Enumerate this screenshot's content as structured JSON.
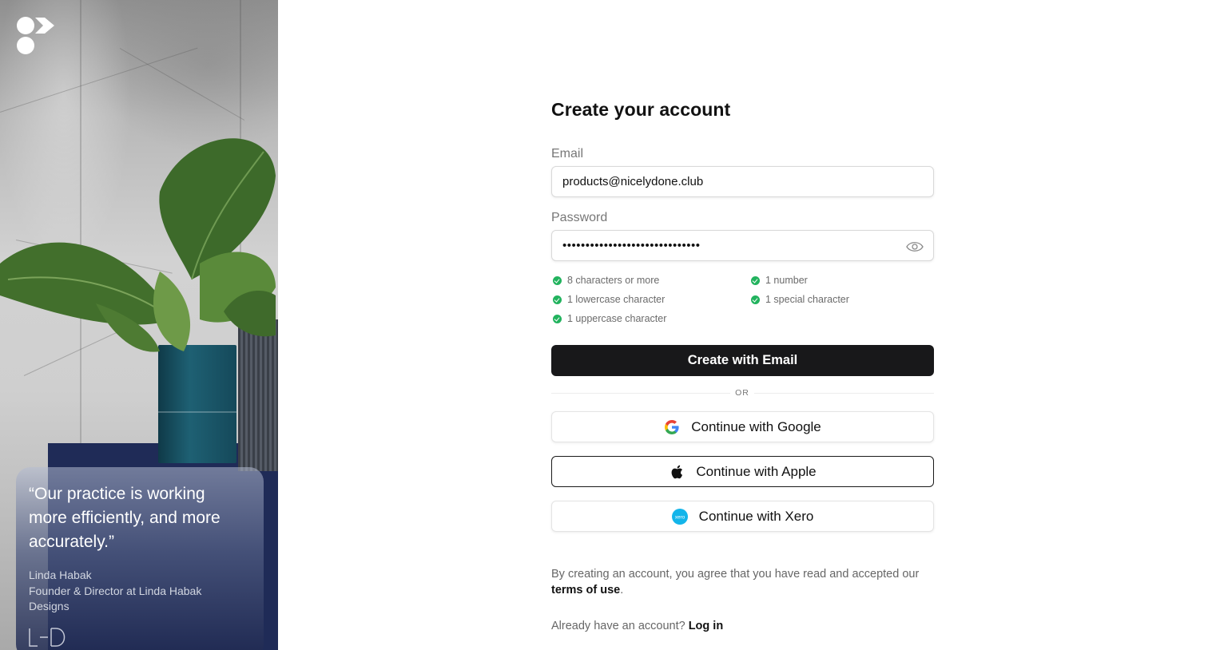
{
  "side_panel": {
    "quote": "“Our practice is working more efficiently, and more accurately.”",
    "author_name": "Linda Habak",
    "author_role": "Founder & Director at Linda Habak Designs",
    "brand_logo": "LHD"
  },
  "form": {
    "title": "Create your account",
    "email_label": "Email",
    "email_value": "products@nicelydone.club",
    "password_label": "Password",
    "password_value": "••••••••••••••••••••••••••••••",
    "requirements": [
      {
        "label": "8 characters or more",
        "met": true
      },
      {
        "label": "1 lowercase character",
        "met": true
      },
      {
        "label": "1 uppercase character",
        "met": true
      },
      {
        "label": "1 number",
        "met": true
      },
      {
        "label": "1 special character",
        "met": true
      }
    ],
    "primary_button": "Create with Email",
    "divider_text": "OR",
    "google_button": "Continue with Google",
    "apple_button": "Continue with Apple",
    "xero_button": "Continue with Xero",
    "terms_prefix": "By creating an account, you agree that you have read and accepted our",
    "terms_link": "terms of use",
    "terms_suffix": ".",
    "login_prompt": "Already have an account?",
    "login_link": "Log in"
  },
  "colors": {
    "primary_button": "#18181a",
    "check": "#22b35e",
    "xero": "#13b5ea",
    "panel_navy": "#1f2b57"
  },
  "icons": [
    "app-logo",
    "eye-icon",
    "check-icon",
    "google-icon",
    "apple-icon",
    "xero-icon",
    "lhd-logo"
  ]
}
